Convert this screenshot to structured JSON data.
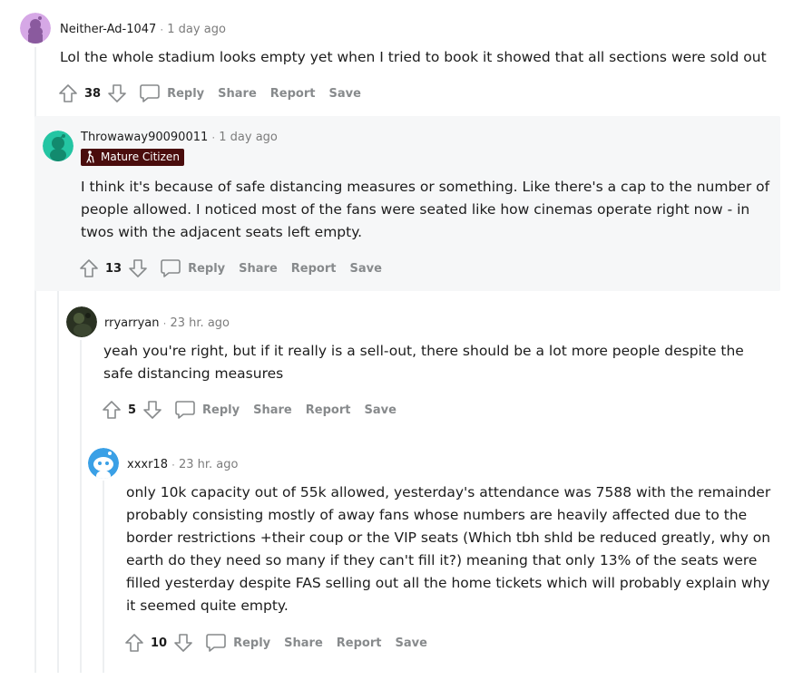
{
  "comments": [
    {
      "author": "Neither-Ad-1047",
      "time": "1 day ago",
      "body": "Lol the whole stadium looks empty yet when I tried to book it showed that all sections were sold out",
      "score": "38",
      "avatar_color": "#d6a8e6"
    },
    {
      "author": "Throwaway90090011",
      "time": "1 day ago",
      "flair": "Mature Citizen",
      "body_lines": [
        "I think it's because of safe distancing measures or something. Like there's a cap to the number of",
        "people allowed. I noticed most of the fans were seated like how cinemas operate right now - in",
        "twos with the adjacent seats left empty."
      ],
      "score": "13",
      "avatar_color": "#24c5a3"
    },
    {
      "author": "rryarryan",
      "time": "23 hr. ago",
      "body_lines": [
        "yeah you're right, but if it really is a sell-out, there should be a lot more people despite the",
        "safe distancing measures"
      ],
      "score": "5",
      "avatar_color": "#2a3222"
    },
    {
      "author": "xxxr18",
      "time": "23 hr. ago",
      "body_lines": [
        "only 10k capacity out of 55k allowed, yesterday's attendance was 7588 with the remainder",
        "probably consisting mostly of away fans whose numbers are heavily affected due to the",
        "border restrictions +their coup or the VIP seats (Which tbh shld be reduced greatly, why on",
        "earth do they need so many if they can't fill it?) meaning that only 13% of the seats were",
        "filled yesterday despite FAS selling out all the home tickets which will probably explain why",
        "it seemed quite empty."
      ],
      "score": "10",
      "avatar_color": "#3aa0e6"
    }
  ],
  "actions": {
    "reply": "Reply",
    "share": "Share",
    "report": "Report",
    "save": "Save"
  },
  "icons": {
    "upvote": "upvote-arrow-icon",
    "downvote": "downvote-arrow-icon",
    "reply": "speech-bubble-icon",
    "flair": "person-cane-icon"
  },
  "colors": {
    "highlight_bg": "#f6f7f8",
    "flair_bg": "#4a0d0d",
    "muted_text": "#878a8c",
    "thread_line": "#edeff1"
  }
}
